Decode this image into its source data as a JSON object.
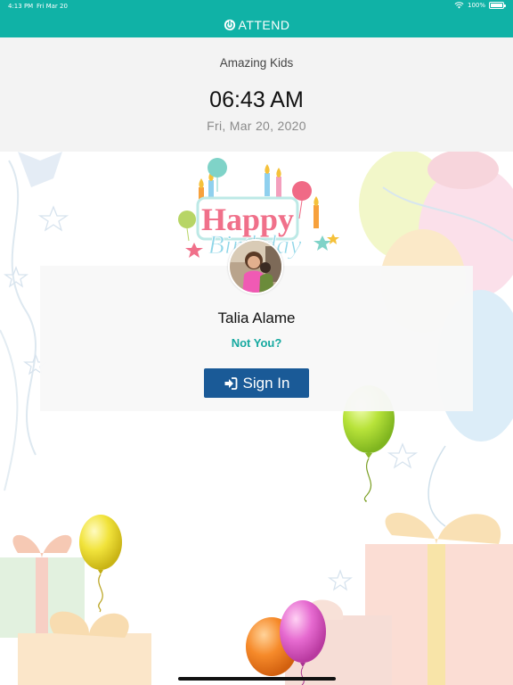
{
  "status_bar": {
    "time": "4:13 PM",
    "date": "Fri Mar 20",
    "battery": "100%"
  },
  "header": {
    "brand": "ATTEND",
    "icon": "power-icon",
    "color": "#10b2a6"
  },
  "info": {
    "organization": "Amazing Kids",
    "clock": "06:43 AM",
    "date": "Fri, Mar  20, 2020"
  },
  "greeting": {
    "line1": "Happy",
    "line2": "Birthday"
  },
  "person": {
    "name": "Talia Alame",
    "not_you_label": "Not You?",
    "sign_in_label": "Sign In",
    "sign_in_icon": "sign-in-icon"
  },
  "colors": {
    "accent": "#10b2a6",
    "button": "#1a5a97",
    "link": "#16a9a0"
  }
}
